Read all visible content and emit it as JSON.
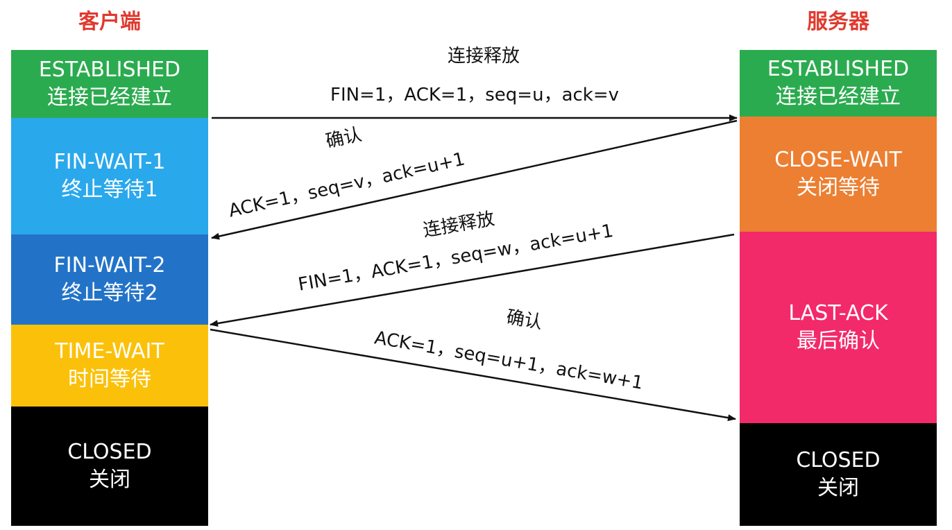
{
  "client": {
    "title": "客户端",
    "states": [
      {
        "en": "ESTABLISHED",
        "zh": "连接已经建立",
        "color": "#2bab4f"
      },
      {
        "en": "FIN-WAIT-1",
        "zh": "终止等待1",
        "color": "#2aa8ec"
      },
      {
        "en": "FIN-WAIT-2",
        "zh": "终止等待2",
        "color": "#2273c8"
      },
      {
        "en": "TIME-WAIT",
        "zh": "时间等待",
        "color": "#fbc10a"
      },
      {
        "en": "CLOSED",
        "zh": "关闭",
        "color": "#000000"
      }
    ]
  },
  "server": {
    "title": "服务器",
    "states": [
      {
        "en": "ESTABLISHED",
        "zh": "连接已经建立",
        "color": "#2bab4f"
      },
      {
        "en": "CLOSE-WAIT",
        "zh": "关闭等待",
        "color": "#ec7f32"
      },
      {
        "en": "LAST-ACK",
        "zh": "最后确认",
        "color": "#f22a6a"
      },
      {
        "en": "CLOSED",
        "zh": "关闭",
        "color": "#000000"
      }
    ]
  },
  "messages": [
    {
      "name": "连接释放",
      "fields": "FIN=1，ACK=1，seq=u，ack=v",
      "direction": "client-to-server"
    },
    {
      "name": "确认",
      "fields": "ACK=1，seq=v，ack=u+1",
      "direction": "server-to-client"
    },
    {
      "name": "连接释放",
      "fields": "FIN=1，ACK=1，seq=w，ack=u+1",
      "direction": "server-to-client"
    },
    {
      "name": "确认",
      "fields": "ACK=1，seq=u+1，ack=w+1",
      "direction": "client-to-server"
    }
  ]
}
